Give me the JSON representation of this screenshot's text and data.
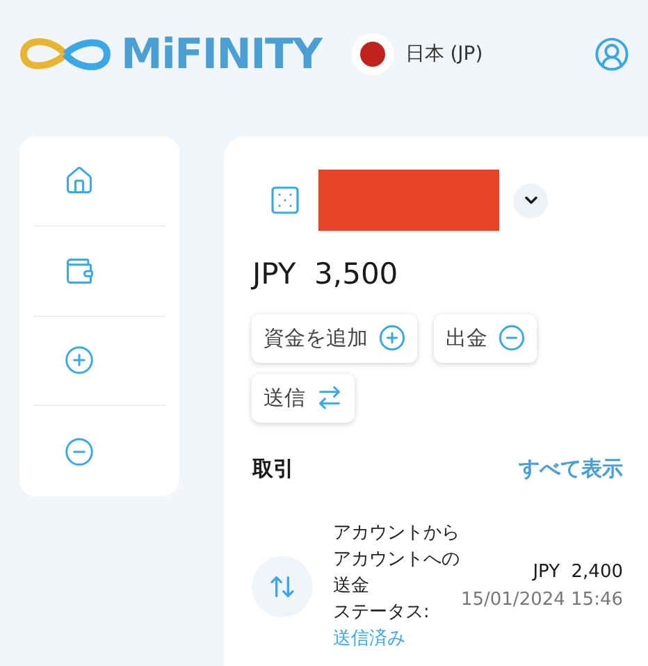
{
  "header": {
    "brand": "MiFINITY",
    "language": "日本 (JP)"
  },
  "sidebar": {
    "items": [
      {
        "kind": "home"
      },
      {
        "kind": "wallet"
      },
      {
        "kind": "add"
      },
      {
        "kind": "remove"
      }
    ]
  },
  "account": {
    "balance": "JPY  3,500",
    "actions": [
      {
        "label": "資金を追加",
        "kind": "add"
      },
      {
        "label": "出金",
        "kind": "withdraw"
      },
      {
        "label": "送信",
        "kind": "send"
      }
    ]
  },
  "transactions": {
    "title": "取引",
    "view_all": "すべて表示",
    "items": [
      {
        "description": "アカウントからアカウントへの送金",
        "status_label": "ステータス:",
        "status": "送信済み",
        "amount": "JPY  2,400",
        "date": "15/01/2024 15:46"
      }
    ]
  }
}
